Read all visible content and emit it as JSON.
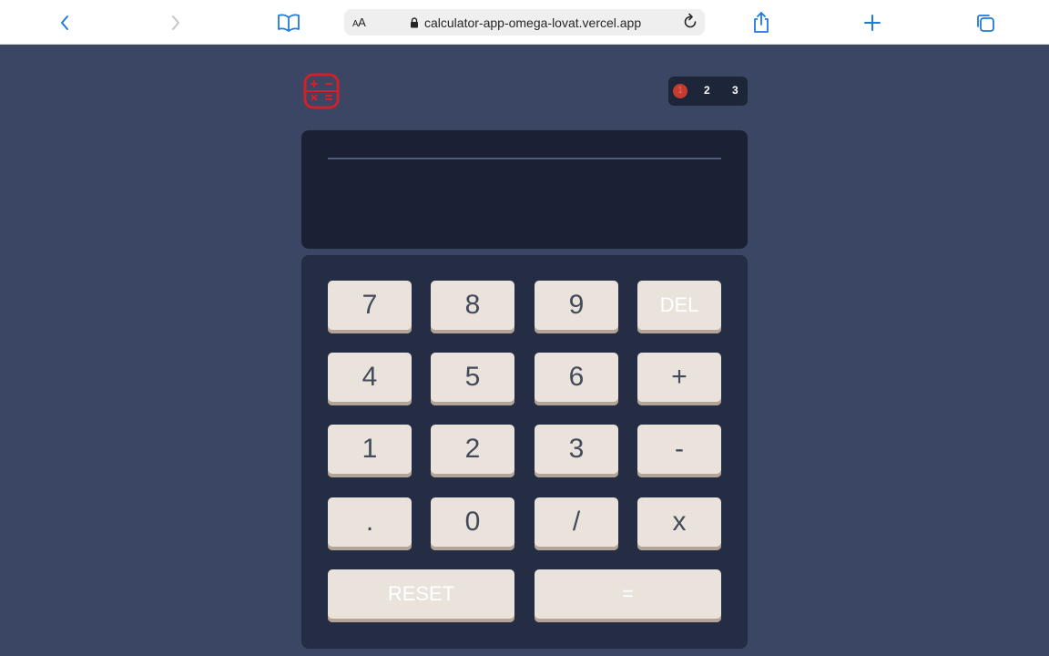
{
  "browser": {
    "aa_label": "AA",
    "url": "calculator-app-omega-lovat.vercel.app",
    "icons": [
      "chevron-left-icon",
      "chevron-right-icon",
      "book-icon",
      "lock-icon",
      "reload-icon",
      "share-icon",
      "plus-icon",
      "tabs-icon"
    ]
  },
  "app": {
    "theme_switch": {
      "options": [
        "1",
        "2",
        "3"
      ],
      "selected": "1"
    },
    "display": {
      "value": ""
    },
    "keys": {
      "k7": "7",
      "k8": "8",
      "k9": "9",
      "del": "DEL",
      "k4": "4",
      "k5": "5",
      "k6": "6",
      "plus": "+",
      "k1": "1",
      "k2": "2",
      "k3": "3",
      "minus": "-",
      "dot": ".",
      "k0": "0",
      "divide": "/",
      "multiply": "x",
      "reset": "RESET",
      "equals": "="
    },
    "colors": {
      "background": "#3a4663",
      "keypad": "#242d44",
      "display": "#1a2134",
      "key": "#eae3dc",
      "key_shadow": "#b3a497",
      "key_text": "#434a59",
      "accent": "#c43b30",
      "logo": "#d0202a"
    }
  }
}
